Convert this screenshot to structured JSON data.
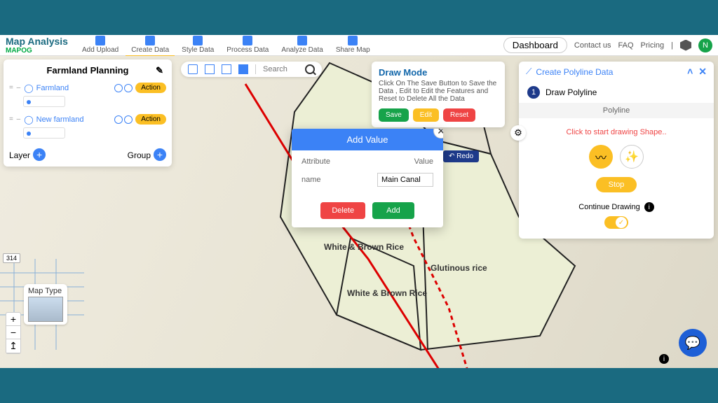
{
  "logo": {
    "title": "Map Analysis",
    "sub": "MAPOG"
  },
  "menu": [
    "Add Upload",
    "Create Data",
    "Style Data",
    "Process Data",
    "Analyze Data",
    "Share Map"
  ],
  "menu_active_index": 1,
  "topbar_right": {
    "dashboard": "Dashboard",
    "contact": "Contact us",
    "faq": "FAQ",
    "pricing": "Pricing",
    "avatar": "N"
  },
  "layers_panel": {
    "title": "Farmland Planning",
    "layers": [
      {
        "name": "Farmland",
        "action": "Action"
      },
      {
        "name": "New farmland",
        "action": "Action"
      }
    ],
    "footer": {
      "layer": "Layer",
      "group": "Group"
    }
  },
  "map_toolbar": {
    "search_placeholder": "Search"
  },
  "draw_mode": {
    "title": "Draw Mode",
    "text": "Click On The Save Button to Save the Data , Edit to Edit the Features and Reset to Delete All the Data",
    "save": "Save",
    "edit": "Edit",
    "reset": "Reset"
  },
  "redo": "↶ Redo",
  "modal": {
    "title": "Add Value",
    "col_attr": "Attribute",
    "col_val": "Value",
    "attr_name": "name",
    "value": "Main Canal",
    "delete": "Delete",
    "add": "Add"
  },
  "poly_panel": {
    "title": "Create Polyline Data",
    "step_label": "Draw Polyline",
    "sub": "Polyline",
    "hint": "Click to start drawing Shape..",
    "stop": "Stop",
    "continue_label": "Continue Drawing"
  },
  "map_labels": {
    "wb1": "White & Brown Rice",
    "wb2": "White & Brown Rice",
    "glut": "Glutinous rice",
    "maptype": "Map Type",
    "road_badge": "314"
  }
}
